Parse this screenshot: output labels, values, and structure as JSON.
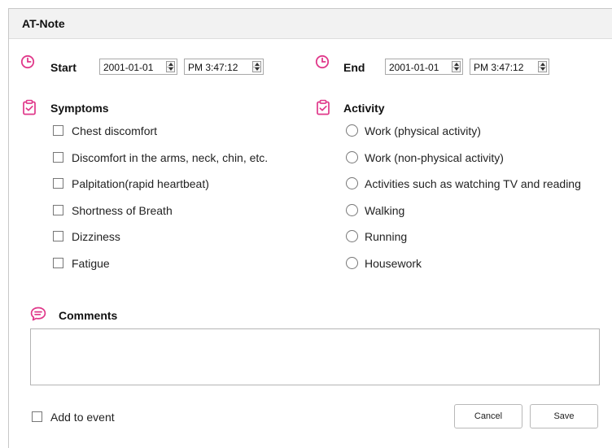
{
  "window": {
    "title": "AT-Note"
  },
  "start": {
    "label": "Start",
    "date": "2001-01-01",
    "time": "PM 3:47:12"
  },
  "end": {
    "label": "End",
    "date": "2001-01-01",
    "time": "PM 3:47:12"
  },
  "symptoms": {
    "label": "Symptoms",
    "items": [
      {
        "label": "Chest discomfort",
        "checked": false
      },
      {
        "label": "Discomfort in the arms, neck, chin, etc.",
        "checked": false
      },
      {
        "label": "Palpitation(rapid heartbeat)",
        "checked": false
      },
      {
        "label": "Shortness of Breath",
        "checked": false
      },
      {
        "label": "Dizziness",
        "checked": false
      },
      {
        "label": "Fatigue",
        "checked": false
      }
    ]
  },
  "activity": {
    "label": "Activity",
    "items": [
      {
        "label": "Work (physical activity)",
        "selected": false
      },
      {
        "label": "Work (non-physical activity)",
        "selected": false
      },
      {
        "label": "Activities such as watching TV and reading",
        "selected": false
      },
      {
        "label": "Walking",
        "selected": false
      },
      {
        "label": "Running",
        "selected": false
      },
      {
        "label": "Housework",
        "selected": false
      }
    ]
  },
  "comments": {
    "label": "Comments",
    "value": ""
  },
  "footer": {
    "add_to_event_label": "Add to event",
    "add_to_event_checked": false,
    "cancel_label": "Cancel",
    "save_label": "Save"
  },
  "colors": {
    "accent": "#e0388a"
  },
  "icons": {
    "start": "clock-icon",
    "end": "clock-icon",
    "symptoms": "clipboard-check-icon",
    "activity": "clipboard-check-icon",
    "comments": "chat-bubble-icon"
  }
}
